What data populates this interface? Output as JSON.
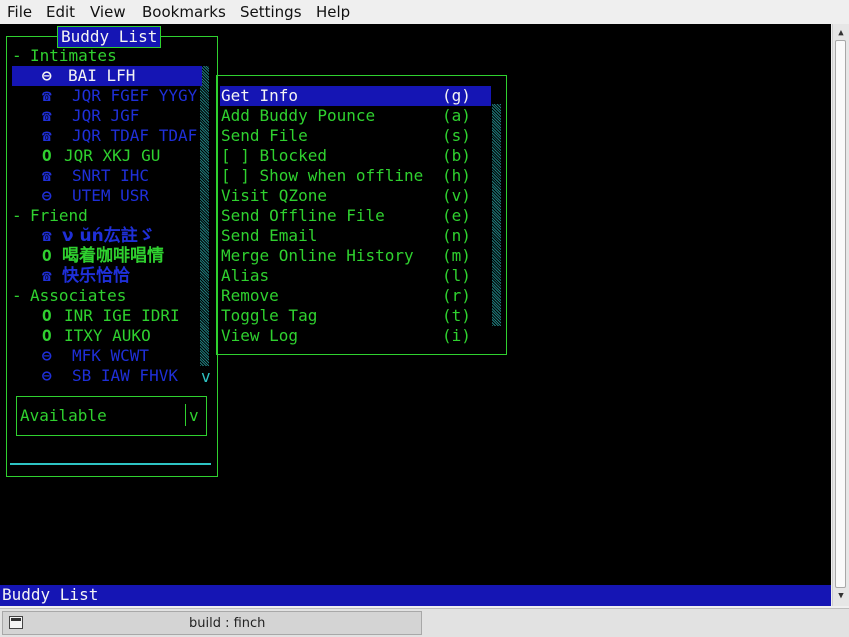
{
  "menubar": {
    "items": [
      "File",
      "Edit",
      "View",
      "Bookmarks",
      "Settings",
      "Help"
    ]
  },
  "buddy_list": {
    "title": "Buddy List",
    "groups": [
      {
        "toggle": "-",
        "name": "Intimates",
        "buddies": [
          {
            "icon": "⊖",
            "icon_name": "away-icon",
            "name": "BAI LFH"
          },
          {
            "icon": "☎",
            "icon_name": "mobile-icon",
            "name": "JQR FGEF YYGY"
          },
          {
            "icon": "☎",
            "icon_name": "mobile-icon",
            "name": "JQR JGF"
          },
          {
            "icon": "☎",
            "icon_name": "mobile-icon",
            "name": "JQR TDAF TDAF"
          },
          {
            "icon": "O",
            "icon_name": "online-icon",
            "name": "JQR XKJ GU"
          },
          {
            "icon": "☎",
            "icon_name": "mobile-icon",
            "name": "SNRT IHC"
          },
          {
            "icon": "⊖",
            "icon_name": "away-icon",
            "name": "UTEM USR"
          }
        ]
      },
      {
        "toggle": "-",
        "name": "Friend",
        "buddies": [
          {
            "icon": "☎",
            "icon_name": "mobile-icon",
            "name": "ν ŭń厷註ゞ"
          },
          {
            "icon": "O",
            "icon_name": "online-icon",
            "name": "喝着咖啡唱情"
          },
          {
            "icon": "☎",
            "icon_name": "mobile-icon",
            "name": "快乐恰恰"
          }
        ]
      },
      {
        "toggle": "-",
        "name": "Associates",
        "buddies": [
          {
            "icon": "O",
            "icon_name": "online-icon",
            "name": "INR IGE IDRI"
          },
          {
            "icon": "O",
            "icon_name": "online-icon",
            "name": "ITXY AUKO"
          },
          {
            "icon": "⊖",
            "icon_name": "away-icon",
            "name": "MFK WCWT"
          },
          {
            "icon": "⊖",
            "icon_name": "away-icon",
            "name": "SB IAW FHVK"
          }
        ]
      }
    ],
    "more_indicator": "v",
    "status": {
      "value": "Available",
      "dropdown": "v"
    }
  },
  "context_menu": {
    "items": [
      {
        "label": "Get Info",
        "key": "(g)"
      },
      {
        "label": "Add Buddy Pounce",
        "key": "(a)"
      },
      {
        "label": "Send File",
        "key": "(s)"
      },
      {
        "label": "[ ] Blocked",
        "key": "(b)"
      },
      {
        "label": "[ ] Show when offline",
        "key": "(h)"
      },
      {
        "label": "Visit QZone",
        "key": "(v)"
      },
      {
        "label": "Send Offline File",
        "key": "(e)"
      },
      {
        "label": "Send Email",
        "key": "(n)"
      },
      {
        "label": "Merge Online History",
        "key": "(m)"
      },
      {
        "label": "Alias",
        "key": "(l)"
      },
      {
        "label": "Remove",
        "key": "(r)"
      },
      {
        "label": "Toggle Tag",
        "key": "(t)"
      },
      {
        "label": "View Log",
        "key": "(i)"
      }
    ]
  },
  "statusbar": {
    "text": "Buddy List"
  },
  "taskbar": {
    "task_label": "build : finch",
    "task_icon": "terminal-icon"
  },
  "colors": {
    "green": "#2fd12f",
    "blue": "#1f2fd8",
    "selection": "#1515b4",
    "cyan": "#2ec4c4",
    "terminal_bg": "#000000"
  }
}
